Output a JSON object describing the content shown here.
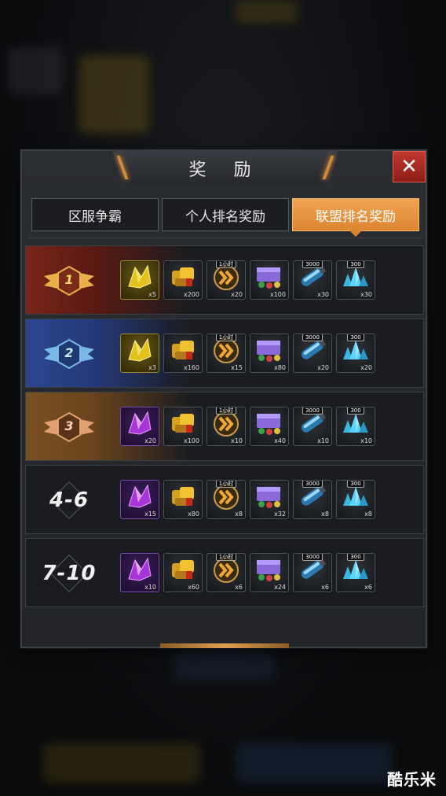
{
  "dialog": {
    "title": "奖 励",
    "close_label": "✕"
  },
  "tabs": [
    {
      "label": "区服争霸",
      "active": false
    },
    {
      "label": "个人排名奖励",
      "active": false
    },
    {
      "label": "联盟排名奖励",
      "active": true
    }
  ],
  "colors": {
    "accent": "#e89540",
    "close": "#b83026",
    "rank1": "#7a2418",
    "rank2": "#2b468f",
    "rank3": "#7a4f22"
  },
  "rows": [
    {
      "rank": "1",
      "items": [
        {
          "icon": "gold-chip-icon",
          "tier": "gold",
          "qty": "x5"
        },
        {
          "icon": "gold-ore-icon",
          "tier": "dark",
          "qty": "x200"
        },
        {
          "icon": "speedup-icon",
          "tier": "dark",
          "tag": "1小时",
          "qty": "x20"
        },
        {
          "icon": "supply-crate-icon",
          "tier": "dark",
          "qty": "x100"
        },
        {
          "icon": "fuel-tank-icon",
          "tier": "dark",
          "tag": "3000",
          "qty": "x30"
        },
        {
          "icon": "crystal-pile-icon",
          "tier": "dark",
          "tag": "300",
          "qty": "x30"
        }
      ]
    },
    {
      "rank": "2",
      "items": [
        {
          "icon": "gold-chip-icon",
          "tier": "gold",
          "qty": "x3"
        },
        {
          "icon": "gold-ore-icon",
          "tier": "dark",
          "qty": "x160"
        },
        {
          "icon": "speedup-icon",
          "tier": "dark",
          "tag": "1小时",
          "qty": "x15"
        },
        {
          "icon": "supply-crate-icon",
          "tier": "dark",
          "qty": "x80"
        },
        {
          "icon": "fuel-tank-icon",
          "tier": "dark",
          "tag": "3000",
          "qty": "x20"
        },
        {
          "icon": "crystal-pile-icon",
          "tier": "dark",
          "tag": "300",
          "qty": "x20"
        }
      ]
    },
    {
      "rank": "3",
      "items": [
        {
          "icon": "purple-chip-icon",
          "tier": "purple",
          "qty": "x20"
        },
        {
          "icon": "gold-ore-icon",
          "tier": "dark",
          "qty": "x100"
        },
        {
          "icon": "speedup-icon",
          "tier": "dark",
          "tag": "1小时",
          "qty": "x10"
        },
        {
          "icon": "supply-crate-icon",
          "tier": "dark",
          "qty": "x40"
        },
        {
          "icon": "fuel-tank-icon",
          "tier": "dark",
          "tag": "3000",
          "qty": "x10"
        },
        {
          "icon": "crystal-pile-icon",
          "tier": "dark",
          "tag": "300",
          "qty": "x10"
        }
      ]
    },
    {
      "rank": "4-6",
      "items": [
        {
          "icon": "purple-chip-icon",
          "tier": "purple",
          "qty": "x15"
        },
        {
          "icon": "gold-ore-icon",
          "tier": "dark",
          "qty": "x80"
        },
        {
          "icon": "speedup-icon",
          "tier": "dark",
          "tag": "1小时",
          "qty": "x8"
        },
        {
          "icon": "supply-crate-icon",
          "tier": "dark",
          "qty": "x32"
        },
        {
          "icon": "fuel-tank-icon",
          "tier": "dark",
          "tag": "3000",
          "qty": "x8"
        },
        {
          "icon": "crystal-pile-icon",
          "tier": "dark",
          "tag": "300",
          "qty": "x8"
        }
      ]
    },
    {
      "rank": "7-10",
      "items": [
        {
          "icon": "purple-chip-icon",
          "tier": "purple",
          "qty": "x10"
        },
        {
          "icon": "gold-ore-icon",
          "tier": "dark",
          "qty": "x60"
        },
        {
          "icon": "speedup-icon",
          "tier": "dark",
          "tag": "1小时",
          "qty": "x6"
        },
        {
          "icon": "supply-crate-icon",
          "tier": "dark",
          "qty": "x24"
        },
        {
          "icon": "fuel-tank-icon",
          "tier": "dark",
          "tag": "3000",
          "qty": "x6"
        },
        {
          "icon": "crystal-pile-icon",
          "tier": "dark",
          "tag": "300",
          "qty": "x6"
        }
      ]
    }
  ],
  "watermark": "酷乐米"
}
